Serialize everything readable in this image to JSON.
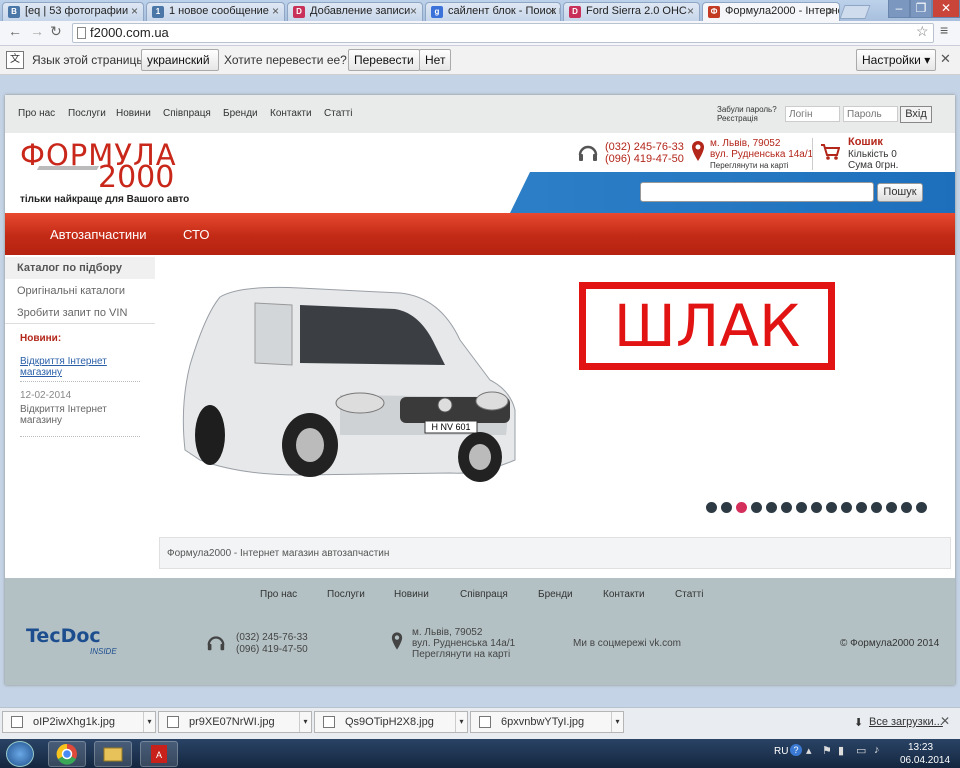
{
  "tabs": [
    {
      "label": "[eq | 53 фотографии",
      "fav": "В",
      "color": "#4a76a8"
    },
    {
      "label": "1 новое сообщение",
      "fav": "1",
      "color": "#4a76a8"
    },
    {
      "label": "Добавление записи",
      "fav": "D",
      "color": "#c8305a"
    },
    {
      "label": "сайлент блок - Поиск в",
      "fav": "g",
      "color": "#3b72d9"
    },
    {
      "label": "Ford Sierra 2.0 OHC",
      "fav": "D",
      "color": "#c8305a"
    },
    {
      "label": "Формула2000 - Інтернет",
      "fav": "Ф",
      "color": "#c23b22"
    }
  ],
  "address": {
    "url": "f2000.com.ua"
  },
  "translate": {
    "prompt": "Язык этой страницы",
    "language": "украинский",
    "question": "Хотите перевести ее?",
    "translate_btn": "Перевести",
    "no_btn": "Нет",
    "settings_btn": "Настройки"
  },
  "topnav": [
    "Про нас",
    "Послуги",
    "Новини",
    "Співпраця",
    "Бренди",
    "Контакти",
    "Статті"
  ],
  "login": {
    "forgot": "Забули пароль?",
    "register": "Реєстрація",
    "login_ph": "Логін",
    "password_ph": "Пароль",
    "submit": "Вхід"
  },
  "logo": {
    "line1": "ФОРМУЛА",
    "line2": "2000",
    "tagline": "тільки найкраще для Вашого авто"
  },
  "contacts": {
    "phone1": "(032) 245-76-33",
    "phone2": "(096) 419-47-50",
    "city": "м. Львів, 79052",
    "street": "вул. Рудненська 14а/1",
    "map": "Переглянути на карті"
  },
  "cart": {
    "title": "Кошик",
    "count": "Кількість 0",
    "sum": "Сума 0грн."
  },
  "search": {
    "button": "Пошук"
  },
  "mainnav": [
    "Автозапчастини",
    "СТО"
  ],
  "sidebar": {
    "items": [
      "Каталог по підбору",
      "Оригінальні каталоги",
      "Зробити запит по VIN"
    ],
    "news_title": "Новини:",
    "news1": "Відкриття Інтернет магазину",
    "news2_date": "12-02-2014",
    "news2_text": "Відкриття Інтернет магазину"
  },
  "banner": {
    "stamp": "ШЛАК",
    "plate": "H NV 601",
    "caption": "Формула2000 - Інтернет магазин автозапчастин",
    "dots_total": 15,
    "dots_active": 3
  },
  "footer": {
    "nav": [
      "Про нас",
      "Послуги",
      "Новини",
      "Співпраця",
      "Бренди",
      "Контакти",
      "Статті"
    ],
    "tecdoc": "TecDoc",
    "inside": "INSIDE",
    "phone1": "(032) 245-76-33",
    "phone2": "(096) 419-47-50",
    "city": "м. Львів, 79052",
    "street": "вул. Рудненська 14а/1",
    "map": "Переглянути на карті",
    "social": "Ми в соцмережі vk.com",
    "copyright": "© Формула2000 2014"
  },
  "downloads": {
    "files": [
      "oIP2iwXhg1k.jpg",
      "pr9XE07NrWI.jpg",
      "Qs9OTipH2X8.jpg",
      "6pxvnbwYTyI.jpg"
    ],
    "all": "Все загрузки..."
  },
  "taskbar": {
    "lang": "RU",
    "time": "13:23",
    "date": "06.04.2014"
  }
}
